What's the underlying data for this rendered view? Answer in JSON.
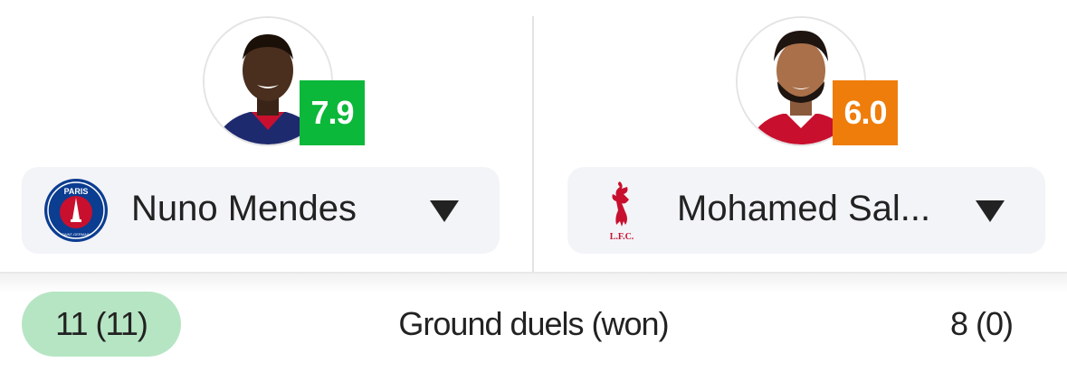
{
  "comparison": {
    "left": {
      "player_name": "Nuno Mendes",
      "rating": "7.9",
      "rating_color": "#0bb83a",
      "team_logo": "psg-logo-icon",
      "logo_text_top": "PARIS",
      "logo_text_bottom": "SAINT-GERMAIN"
    },
    "right": {
      "player_name": "Mohamed Sal...",
      "rating": "6.0",
      "rating_color": "#ef7d0b",
      "team_logo": "liverpool-logo-icon",
      "logo_text": "L.F.C."
    }
  },
  "stat": {
    "label": "Ground duels (won)",
    "left_value": "11 (11)",
    "right_value": "8 (0)",
    "highlight_color": "#b6e5c3"
  }
}
